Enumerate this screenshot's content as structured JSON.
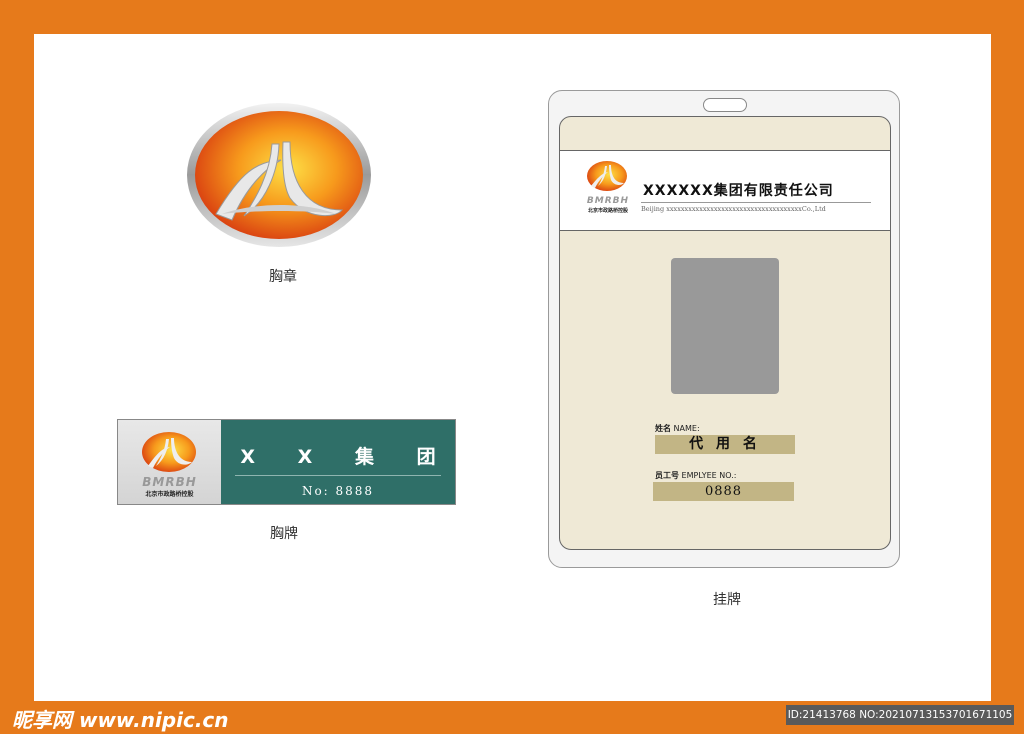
{
  "emblem": {
    "caption": "胸章"
  },
  "name_plate": {
    "logo_text": "BMRBH",
    "logo_subtext": "北京市政路桥控股",
    "title": "X X 集 团",
    "number": "No: 8888",
    "caption": "胸牌"
  },
  "hanging_badge": {
    "logo_text": "BMRBH",
    "logo_subtext": "北京市政路桥控股",
    "company_name": "XXXXXX集团有限责任公司",
    "company_subline": "Beijing xxxxxxxxxxxxxxxxxxxxxxxxxxxxxxxxxxxxxCo.,Ltd",
    "name_label_cn": "姓名",
    "name_label_en": "NAME:",
    "name_value": "代 用 名",
    "employee_label_cn": "员工号",
    "employee_label_en": "EMPLYEE NO.:",
    "employee_value": "0888",
    "caption": "挂牌"
  },
  "watermark": {
    "site": "昵享网 www.nipic.cn",
    "id_text": "ID:21413768 NO:20210713153701671105"
  },
  "colors": {
    "border_orange": "#e67a1b",
    "plate_teal": "#2f6f68",
    "badge_cream": "#efe9d6",
    "field_tan": "#c2b585",
    "logo_red": "#d42a10",
    "logo_orange": "#f7a21b"
  }
}
